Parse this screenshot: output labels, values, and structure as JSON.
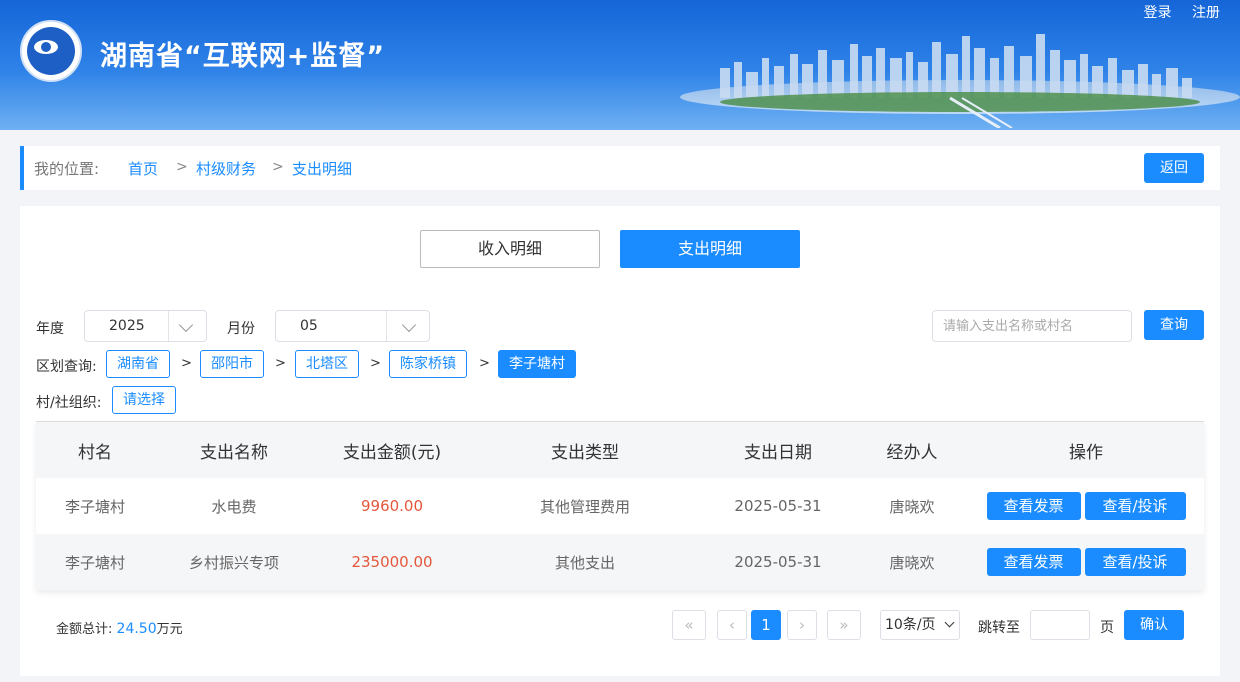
{
  "header": {
    "site_title": "湖南省“互联网+监督”",
    "login": "登录",
    "register": "注册"
  },
  "breadcrumb": {
    "label": "我的位置:",
    "items": [
      "首页",
      "村级财务",
      "支出明细"
    ],
    "separator": ">",
    "back_button": "返回"
  },
  "tabs": {
    "income": "收入明细",
    "expense": "支出明细",
    "active": "expense"
  },
  "filters": {
    "year_label": "年度",
    "year_value": "2025",
    "month_label": "月份",
    "month_value": "05",
    "search_placeholder": "请输入支出名称或村名",
    "query_button": "查询",
    "region_label": "区划查询:",
    "regions": [
      "湖南省",
      "邵阳市",
      "北塔区",
      "陈家桥镇",
      "李子塘村"
    ],
    "org_label": "村/社组织:",
    "org_select": "请选择"
  },
  "table": {
    "columns": [
      "村名",
      "支出名称",
      "支出金额(元)",
      "支出类型",
      "支出日期",
      "经办人",
      "操作"
    ],
    "rows": [
      {
        "village": "李子塘村",
        "name": "水电费",
        "amount": "9960.00",
        "type": "其他管理费用",
        "date": "2025-05-31",
        "handler": "唐晓欢"
      },
      {
        "village": "李子塘村",
        "name": "乡村振兴专项",
        "amount": "235000.00",
        "type": "其他支出",
        "date": "2025-05-31",
        "handler": "唐晓欢"
      }
    ],
    "action_invoice": "查看发票",
    "action_complain": "查看/投诉"
  },
  "footer": {
    "total_label": "金额总计:",
    "total_value": "24.50",
    "total_unit": "万元",
    "first": "«",
    "prev": "‹",
    "current_page": "1",
    "next": "›",
    "last": "»",
    "page_size": "10条/页",
    "jump_label": "跳转至",
    "page_unit": "页",
    "confirm": "确认"
  },
  "colors": {
    "primary": "#1a8cff",
    "amount": "#e4573b",
    "header_top": "#1565d8"
  }
}
